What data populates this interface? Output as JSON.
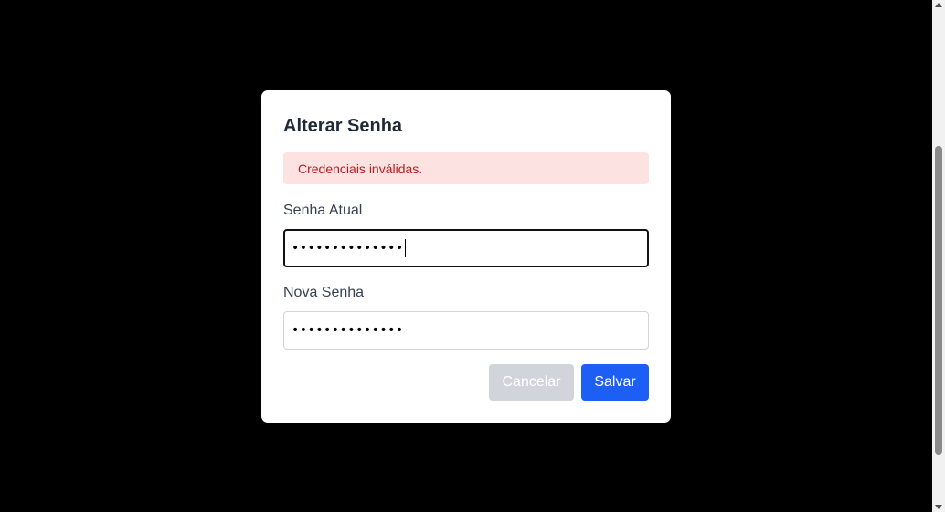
{
  "modal": {
    "title": "Alterar Senha",
    "error_message": "Credenciais inválidas.",
    "fields": {
      "current_password": {
        "label": "Senha Atual",
        "masked_value": "••••••••••••••",
        "focused": true
      },
      "new_password": {
        "label": "Nova Senha",
        "masked_value": "••••••••••••••"
      }
    },
    "buttons": {
      "cancel_label": "Cancelar",
      "save_label": "Salvar"
    }
  },
  "colors": {
    "backdrop": "#000000",
    "alert_bg": "#fde2e2",
    "alert_text": "#b91c1c",
    "primary": "#1d5ff5",
    "cancel_disabled": "#d1d5db"
  },
  "icons": {
    "scroll_up": "triangle-up",
    "scroll_down": "triangle-down"
  }
}
